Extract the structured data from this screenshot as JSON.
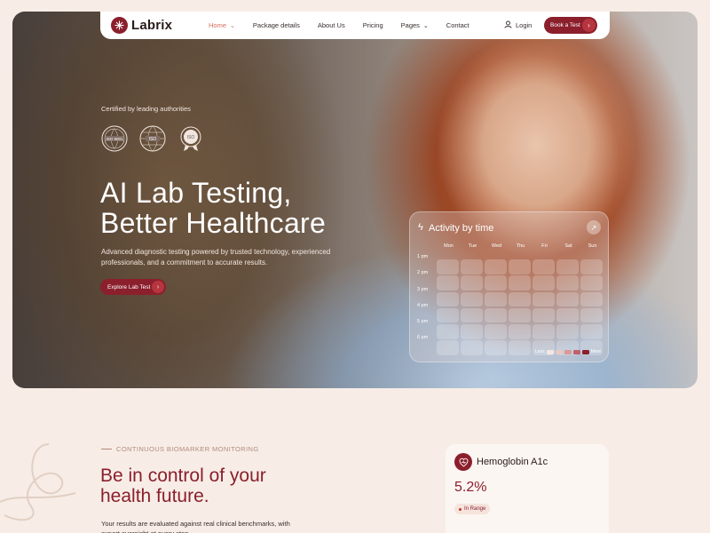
{
  "brand": {
    "name": "Labrix",
    "accent": "#8b1f2c"
  },
  "nav": {
    "links": [
      {
        "label": "Home",
        "chevron": true,
        "active": true
      },
      {
        "label": "Package details",
        "chevron": false
      },
      {
        "label": "About Us",
        "chevron": false
      },
      {
        "label": "Pricing",
        "chevron": false
      },
      {
        "label": "Pages",
        "chevron": true
      },
      {
        "label": "Contact",
        "chevron": false
      }
    ],
    "login_label": "Login",
    "cta_label": "Book a Test"
  },
  "hero": {
    "certified": "Certified by leading authorities",
    "badges": [
      {
        "text": "ISO 9001",
        "icon": "iso-9001-badge-icon"
      },
      {
        "text": "ISO",
        "icon": "iso-globe-badge-icon"
      },
      {
        "text": "ISO",
        "icon": "iso-ribbon-badge-icon"
      }
    ],
    "title_line1": "AI Lab Testing,",
    "title_line2": "Better Healthcare",
    "description": "Advanced diagnostic testing powered by trusted technology, experienced professionals, and a commitment to accurate results.",
    "cta_label": "Explore Lab Test"
  },
  "activity": {
    "title": "Activity by time",
    "days": [
      "Mon",
      "Tue",
      "Wed",
      "Thu",
      "Fri",
      "Sat",
      "Sun"
    ],
    "hours": [
      "1 pm",
      "2 pm",
      "3 pm",
      "4 pm",
      "5 pm",
      "6 pm"
    ],
    "legend_less": "Less",
    "legend_more": "More",
    "legend_colors": [
      "#f3e7e3",
      "#e7c9c3",
      "#d99a97",
      "#c2606a",
      "#8b1f2c"
    ]
  },
  "section": {
    "eyebrow": "CONTINUOUS BIOMARKER MONITORING",
    "title_line1": "Be in control of your",
    "title_line2": "health future.",
    "description": "Your results are evaluated against real clinical benchmarks, with expert oversight at every step."
  },
  "metric": {
    "title": "Hemoglobin A1c",
    "value": "5.2%",
    "status": "In Range"
  }
}
